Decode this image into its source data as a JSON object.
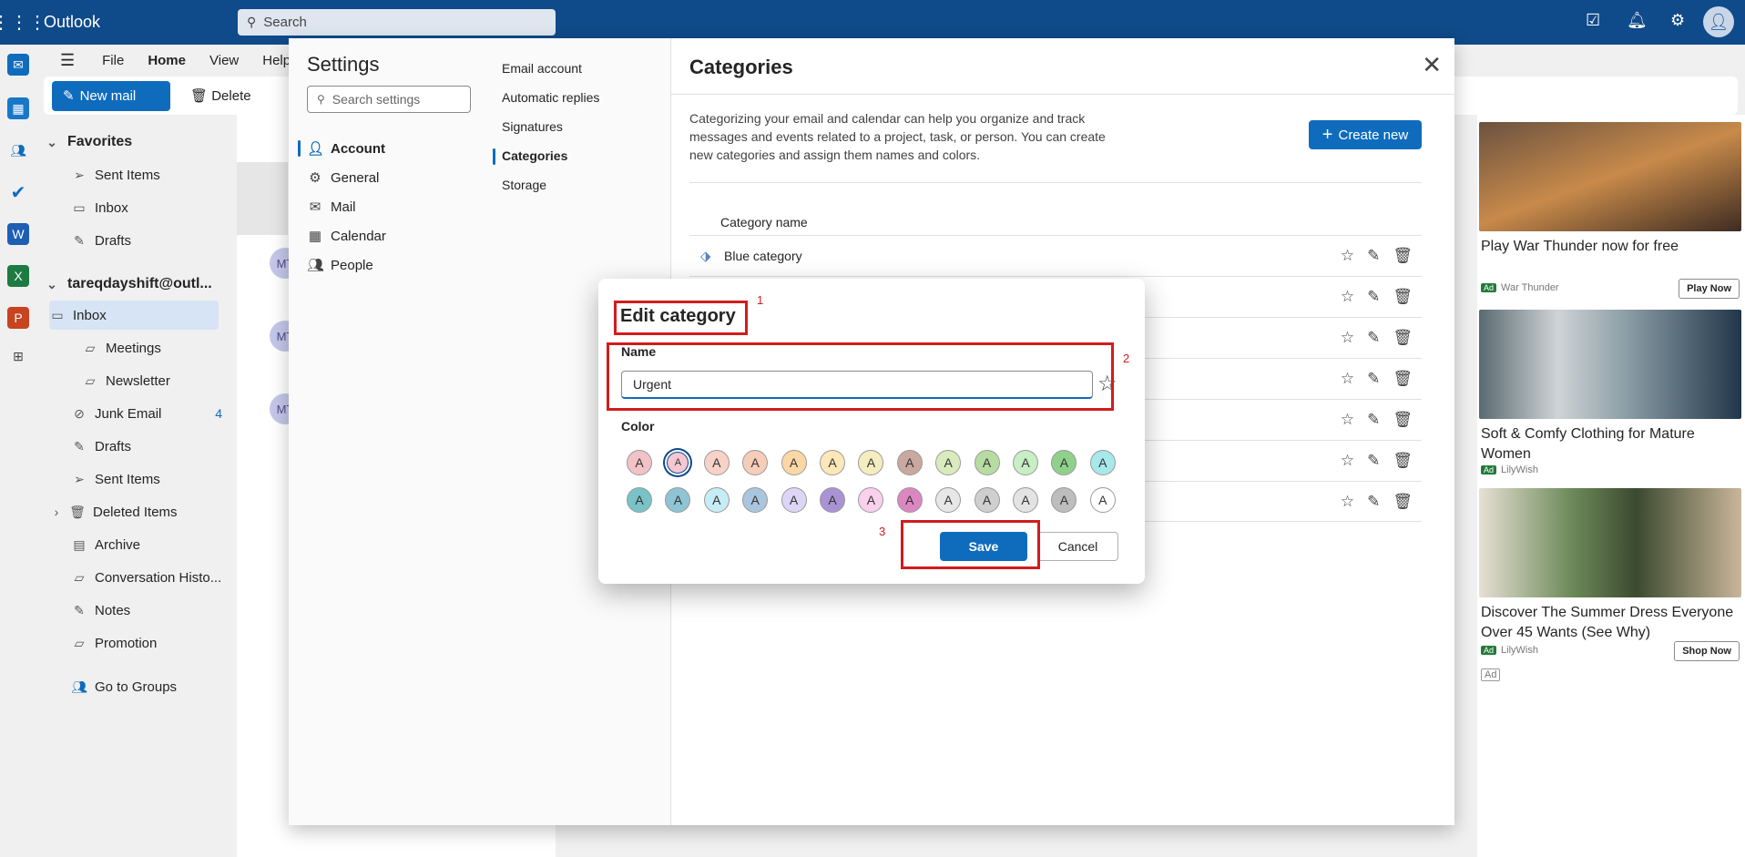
{
  "app": {
    "title": "Outlook",
    "search_placeholder": "Search"
  },
  "ribbon": {
    "tabs": [
      "File",
      "Home",
      "View",
      "Help"
    ],
    "new_mail": "New mail",
    "delete": "Delete"
  },
  "folders": {
    "favorites_label": "Favorites",
    "favorites": [
      "Sent Items",
      "Inbox",
      "Drafts"
    ],
    "account": "tareqdayshift@outl...",
    "items": [
      {
        "label": "Inbox",
        "icon": "inbox-icon"
      },
      {
        "label": "Meetings",
        "icon": "folder-icon"
      },
      {
        "label": "Newsletter",
        "icon": "folder-icon"
      },
      {
        "label": "Junk Email",
        "icon": "junk-icon",
        "count": "4"
      },
      {
        "label": "Drafts",
        "icon": "drafts-icon"
      },
      {
        "label": "Sent Items",
        "icon": "sent-icon"
      },
      {
        "label": "Deleted Items",
        "icon": "trash-icon"
      },
      {
        "label": "Archive",
        "icon": "archive-icon"
      },
      {
        "label": "Conversation Histo...",
        "icon": "folder-icon"
      },
      {
        "label": "Notes",
        "icon": "notes-icon"
      },
      {
        "label": "Promotion",
        "icon": "folder-icon"
      }
    ],
    "go_to_groups": "Go to Groups"
  },
  "messages": {
    "avatars": [
      "MT",
      "MT",
      "MT"
    ]
  },
  "settings": {
    "title": "Settings",
    "search_placeholder": "Search settings",
    "nav1": [
      {
        "label": "Account",
        "icon": "person-icon"
      },
      {
        "label": "General",
        "icon": "gear-icon"
      },
      {
        "label": "Mail",
        "icon": "mail-icon"
      },
      {
        "label": "Calendar",
        "icon": "calendar-icon"
      },
      {
        "label": "People",
        "icon": "people-icon"
      }
    ],
    "nav2": [
      "Email account",
      "Automatic replies",
      "Signatures",
      "Categories",
      "Storage"
    ],
    "categories": {
      "title": "Categories",
      "description": "Categorizing your email and calendar can help you organize and track messages and events related to a project, task, or person. You can create new categories and assign them names and colors.",
      "create_new": "Create new",
      "column_header": "Category name",
      "rows": [
        "Blue category",
        "",
        "",
        "",
        "",
        "",
        ""
      ]
    }
  },
  "dialog": {
    "title": "Edit category",
    "name_label": "Name",
    "name_value": "Urgent",
    "color_label": "Color",
    "swatch_letter": "A",
    "swatches_row1": [
      "#f3c2c6",
      "#f4c7d2",
      "#f7d2c8",
      "#f5cdb8",
      "#fbd7a6",
      "#fde7b8",
      "#f5ecc0",
      "#c9a8a0",
      "#d9ebbd",
      "#b7dca1",
      "#c7eec4",
      "#8fd18b",
      "#a7e8ea"
    ],
    "swatches_row2": [
      "#79c3c8",
      "#8ec4d4",
      "#c6ecf6",
      "#aac6de",
      "#ddd5f5",
      "#a893d4",
      "#f9d1ec",
      "#da87c2",
      "#e7e7e7",
      "#cfcfcf",
      "#e3e3e3",
      "#bdbdbd",
      "#ffffff"
    ],
    "save": "Save",
    "cancel": "Cancel"
  },
  "annotations": [
    "1",
    "2",
    "3"
  ],
  "ads": [
    {
      "title": "Play War Thunder now for free",
      "sponsor": "War Thunder",
      "button": "Play Now"
    },
    {
      "title": "Soft & Comfy Clothing for Mature Women",
      "sponsor": "LilyWish",
      "button": ""
    },
    {
      "title": "Discover The Summer Dress Everyone Over 45 Wants (See Why)",
      "sponsor": "LilyWish",
      "button": "Shop Now"
    }
  ],
  "ad_tag": "Ad"
}
